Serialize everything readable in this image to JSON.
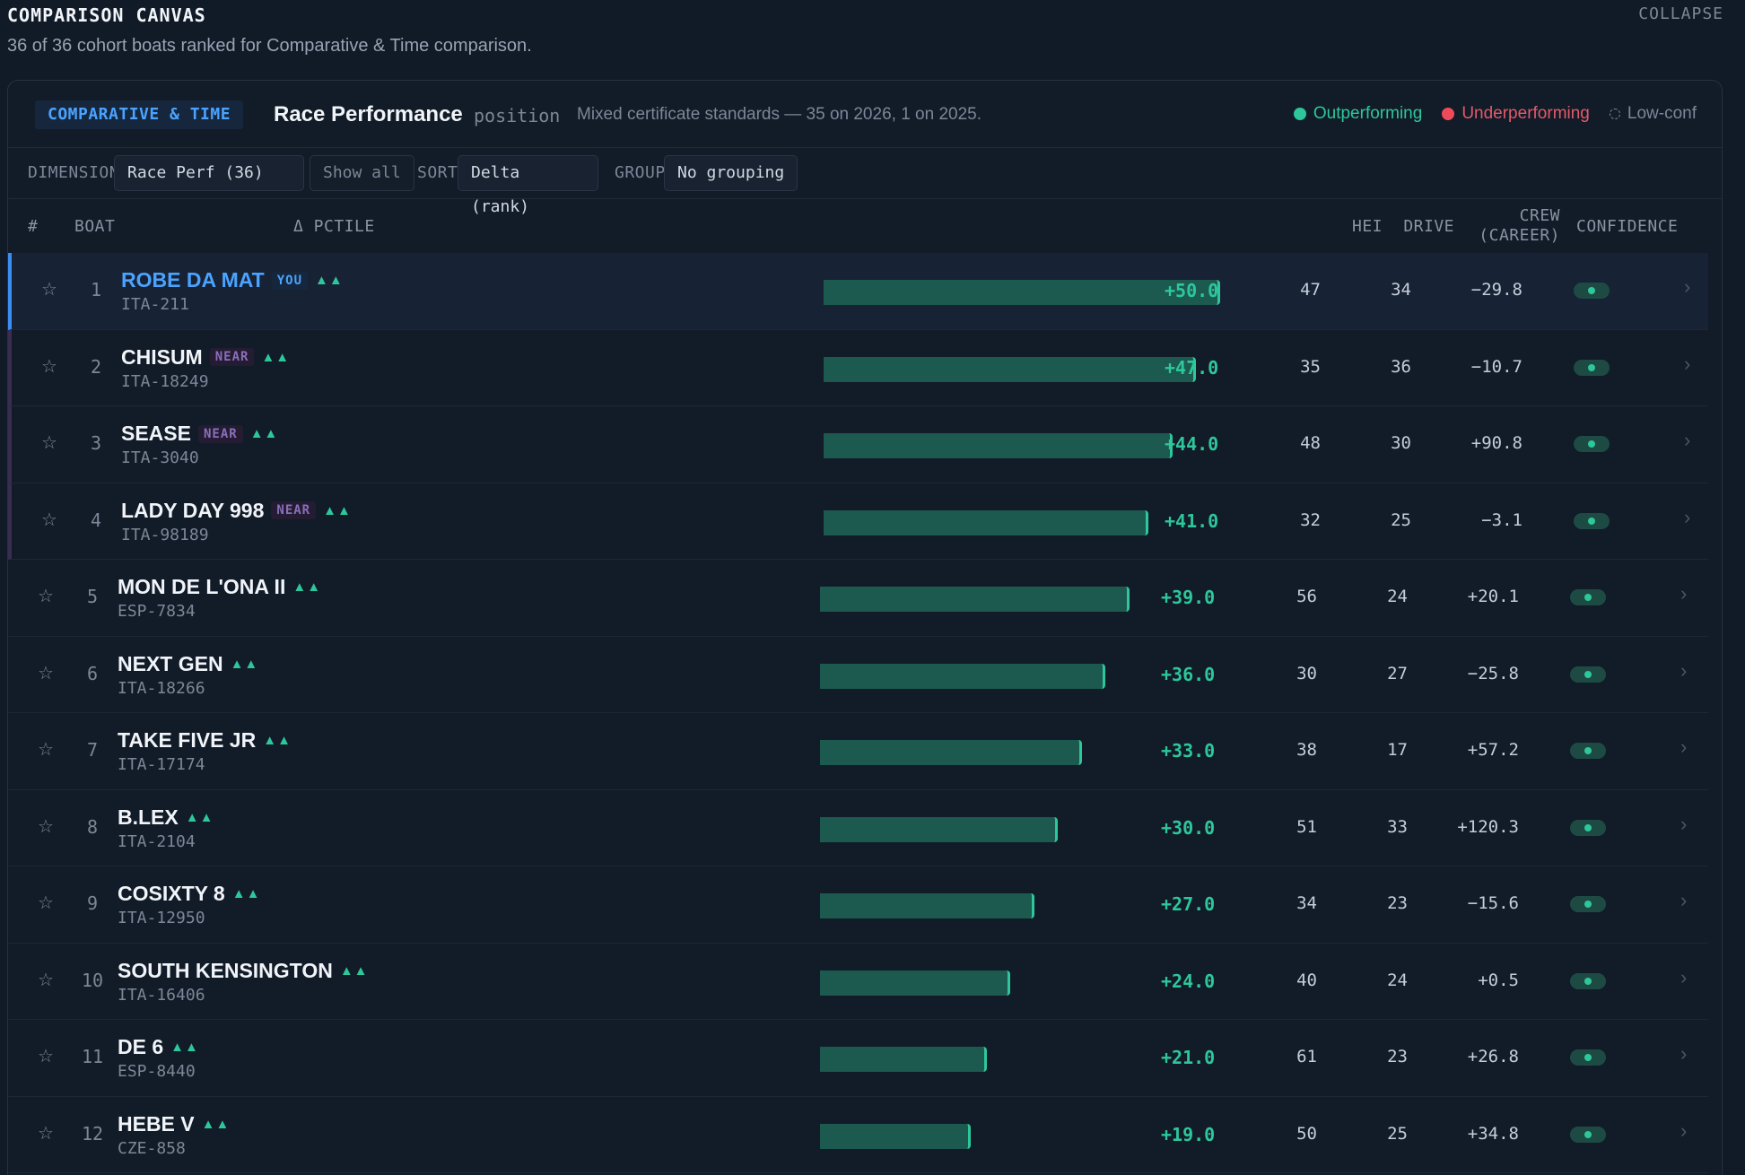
{
  "header": {
    "title": "COMPARISON CANVAS",
    "collapse_label": "COLLAPSE",
    "subtitle": "36 of 36 cohort boats ranked for Comparative & Time comparison."
  },
  "panel": {
    "tag": "COMPARATIVE & TIME",
    "title": "Race Performance",
    "metric": "position",
    "note": "Mixed certificate standards — 35 on 2026, 1 on 2025.",
    "legend": {
      "outperforming": "Outperforming",
      "underperforming": "Underperforming",
      "low_conf": "Low-conf"
    },
    "colors": {
      "outperforming": "#2dc79b",
      "underperforming": "#ef4a5a",
      "accent": "#4aa3ff"
    }
  },
  "controls": {
    "dimension_label": "DIMENSION",
    "dimension_value": "Race Perf (36)",
    "show_all": "Show all",
    "sort_label": "SORT",
    "sort_value": "Delta (rank)",
    "group_label": "GROUP",
    "group_value": "No grouping"
  },
  "columns": {
    "rank": "#",
    "boat": "BOAT",
    "delta": "Δ PCTILE",
    "hei": "HEI",
    "drive": "DRIVE",
    "crew_line1": "CREW",
    "crew_line2": "(CAREER)",
    "confidence": "CONFIDENCE"
  },
  "rows": [
    {
      "rank": "1",
      "name": "ROBE DA MAT",
      "badge": "YOU",
      "trend": "▲▲",
      "sail": "ITA-211",
      "delta": "+50.0",
      "delta_value": 50.0,
      "hei": "47",
      "drive": "34",
      "crew": "−29.8"
    },
    {
      "rank": "2",
      "name": "CHISUM",
      "badge": "NEAR",
      "trend": "▲▲",
      "sail": "ITA-18249",
      "delta": "+47.0",
      "delta_value": 47.0,
      "hei": "35",
      "drive": "36",
      "crew": "−10.7"
    },
    {
      "rank": "3",
      "name": "SEASE",
      "badge": "NEAR",
      "trend": "▲▲",
      "sail": "ITA-3040",
      "delta": "+44.0",
      "delta_value": 44.0,
      "hei": "48",
      "drive": "30",
      "crew": "+90.8"
    },
    {
      "rank": "4",
      "name": "LADY DAY 998",
      "badge": "NEAR",
      "trend": "▲▲",
      "sail": "ITA-98189",
      "delta": "+41.0",
      "delta_value": 41.0,
      "hei": "32",
      "drive": "25",
      "crew": "−3.1"
    },
    {
      "rank": "5",
      "name": "MON DE L'ONA II",
      "badge": "",
      "trend": "▲▲",
      "sail": "ESP-7834",
      "delta": "+39.0",
      "delta_value": 39.0,
      "hei": "56",
      "drive": "24",
      "crew": "+20.1"
    },
    {
      "rank": "6",
      "name": "NEXT GEN",
      "badge": "",
      "trend": "▲▲",
      "sail": "ITA-18266",
      "delta": "+36.0",
      "delta_value": 36.0,
      "hei": "30",
      "drive": "27",
      "crew": "−25.8"
    },
    {
      "rank": "7",
      "name": "TAKE FIVE JR",
      "badge": "",
      "trend": "▲▲",
      "sail": "ITA-17174",
      "delta": "+33.0",
      "delta_value": 33.0,
      "hei": "38",
      "drive": "17",
      "crew": "+57.2"
    },
    {
      "rank": "8",
      "name": "B.LEX",
      "badge": "",
      "trend": "▲▲",
      "sail": "ITA-2104",
      "delta": "+30.0",
      "delta_value": 30.0,
      "hei": "51",
      "drive": "33",
      "crew": "+120.3"
    },
    {
      "rank": "9",
      "name": "COSIXTY 8",
      "badge": "",
      "trend": "▲▲",
      "sail": "ITA-12950",
      "delta": "+27.0",
      "delta_value": 27.0,
      "hei": "34",
      "drive": "23",
      "crew": "−15.6"
    },
    {
      "rank": "10",
      "name": "SOUTH KENSINGTON",
      "badge": "",
      "trend": "▲▲",
      "sail": "ITA-16406",
      "delta": "+24.0",
      "delta_value": 24.0,
      "hei": "40",
      "drive": "24",
      "crew": "+0.5"
    },
    {
      "rank": "11",
      "name": "DE 6",
      "badge": "",
      "trend": "▲▲",
      "sail": "ESP-8440",
      "delta": "+21.0",
      "delta_value": 21.0,
      "hei": "61",
      "drive": "23",
      "crew": "+26.8"
    },
    {
      "rank": "12",
      "name": "HEBE V",
      "badge": "",
      "trend": "▲▲",
      "sail": "CZE-858",
      "delta": "+19.0",
      "delta_value": 19.0,
      "hei": "50",
      "drive": "25",
      "crew": "+34.8"
    }
  ],
  "icons": {
    "star": "star-outline-icon",
    "chevron": "chevron-right-icon",
    "trend": "double-up-triangle-icon"
  }
}
